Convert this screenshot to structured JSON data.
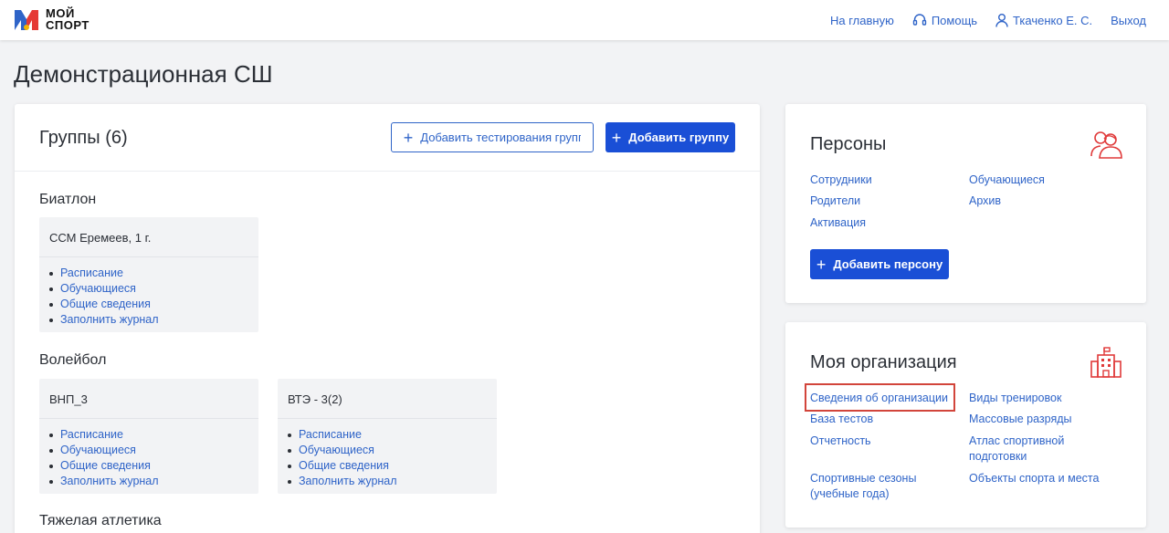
{
  "header": {
    "logo_line1": "МОЙ",
    "logo_line2": "СПОРТ",
    "nav": {
      "home": "На главную",
      "help": "Помощь",
      "user": "Ткаченко Е. С.",
      "logout": "Выход"
    }
  },
  "page": {
    "title": "Демонстрационная СШ"
  },
  "groups": {
    "title": "Группы (6)",
    "add_testing_label": "Добавить тестирования групп",
    "add_group_label": "Добавить группу",
    "sports": [
      {
        "name": "Биатлон",
        "groups": [
          {
            "name": "ССМ Еремеев, 1 г.",
            "links": [
              "Расписание",
              "Обучающиеся",
              "Общие сведения",
              "Заполнить журнал"
            ]
          }
        ]
      },
      {
        "name": "Волейбол",
        "groups": [
          {
            "name": "ВНП_3",
            "links": [
              "Расписание",
              "Обучающиеся",
              "Общие сведения",
              "Заполнить журнал"
            ]
          },
          {
            "name": "ВТЭ - 3(2)",
            "links": [
              "Расписание",
              "Обучающиеся",
              "Общие сведения",
              "Заполнить журнал"
            ]
          }
        ]
      },
      {
        "name": "Тяжелая атлетика",
        "groups": []
      }
    ]
  },
  "persons": {
    "title": "Персоны",
    "links": [
      "Сотрудники",
      "Обучающиеся",
      "Родители",
      "Архив",
      "Активация"
    ],
    "add_label": "Добавить персону"
  },
  "organization": {
    "title": "Моя организация",
    "links": {
      "info": "Сведения об организации",
      "training_types": "Виды тренировок",
      "tests_base": "База тестов",
      "mass_ranks": "Массовые разряды",
      "reports": "Отчетность",
      "atlas_line1": "Атлас спортивной",
      "atlas_line2": "подготовки",
      "seasons_line1": "Спортивные сезоны",
      "seasons_line2": "(учебные года)",
      "objects": "Объекты спорта и места"
    }
  },
  "colors": {
    "accent": "#1a4fd6",
    "link": "#2f64c8",
    "highlight": "#d2453b",
    "icon_red": "#e03a3a"
  }
}
